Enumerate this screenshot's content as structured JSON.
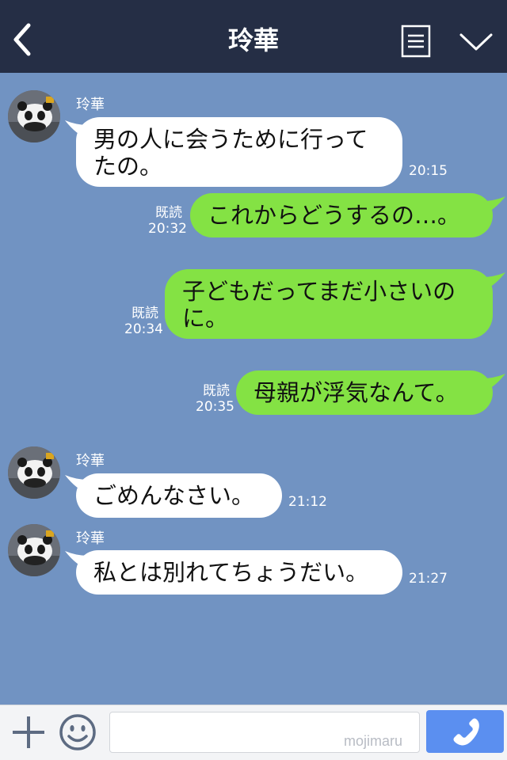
{
  "header": {
    "title": "玲華",
    "background": "#252e45"
  },
  "colors": {
    "chat_background": "#7193c2",
    "incoming_bubble": "#ffffff",
    "outgoing_bubble": "#84e244",
    "call_button": "#5b8ff0"
  },
  "messages": [
    {
      "direction": "in",
      "sender": "玲華",
      "text": "男の人に会うために行ってたの。",
      "lines": [
        "男の人に会うために行って",
        "たの。"
      ],
      "time": "20:15"
    },
    {
      "direction": "out",
      "read": "既読",
      "text": "これからどうするの…。",
      "time": "20:32"
    },
    {
      "direction": "out",
      "read": "既読",
      "text": "子どもだってまだ小さいのに。",
      "lines": [
        "子どもだってまだ小さいの",
        "に。"
      ],
      "time": "20:34"
    },
    {
      "direction": "out",
      "read": "既読",
      "text": "母親が浮気なんて。",
      "time": "20:35"
    },
    {
      "direction": "in",
      "sender": "玲華",
      "text": "ごめんなさい。",
      "time": "21:12"
    },
    {
      "direction": "in",
      "sender": "玲華",
      "text": "私とは別れてちょうだい。",
      "time": "21:27"
    }
  ],
  "input": {
    "value": "",
    "placeholder": "",
    "watermark": "mojimaru"
  },
  "icons": {
    "back": "chevron-left-icon",
    "menu": "document-list-icon",
    "collapse": "chevron-down-icon",
    "plus": "plus-icon",
    "emoji": "smiley-icon",
    "call": "phone-icon"
  }
}
